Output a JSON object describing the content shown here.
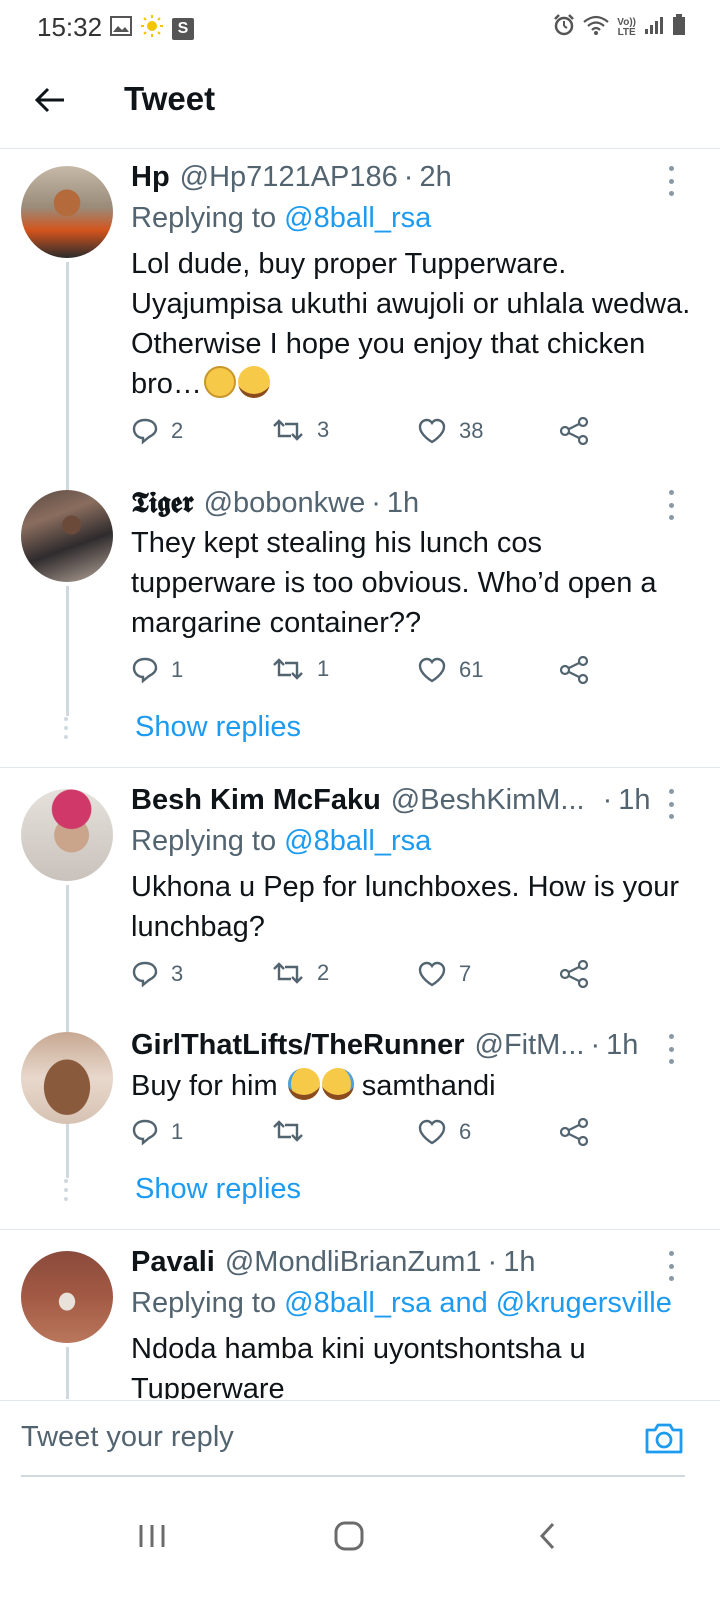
{
  "status_bar": {
    "time": "15:32",
    "volte_top": "Vo))",
    "volte_bottom": "LTE",
    "s_badge": "S"
  },
  "header": {
    "title": "Tweet",
    "back_icon": "arrow-left-icon"
  },
  "colors": {
    "accent": "#1d9bf0",
    "text": "#0f1419",
    "muted": "#536471",
    "divider": "#e1e6ea"
  },
  "tweets": [
    {
      "name": "Hp",
      "handle": "@Hp7121AP186",
      "dot": "·",
      "time": "2h",
      "replying_prefix": "Replying to",
      "replying_to": "@8ball_rsa",
      "text": "Lol dude, buy proper Tupperware. Uyajumpisa ukuthi awujoli or uhlala wedwa. Otherwise I hope you enjoy that chicken bro…",
      "replies": "2",
      "retweets": "3",
      "likes": "38"
    },
    {
      "name": "𝕿𝖎𝖌𝖊𝖗",
      "handle": "@bobonkwe",
      "dot": "·",
      "time": "1h",
      "text": "They kept stealing his lunch cos tupperware is too obvious. Who’d open a margarine container??",
      "replies": "1",
      "retweets": "1",
      "likes": "61",
      "show_replies": "Show replies"
    },
    {
      "name": "Besh Kim McFaku",
      "handle": "@BeshKimM...",
      "dot": "·",
      "time": "1h",
      "replying_prefix": "Replying to",
      "replying_to": "@8ball_rsa",
      "text": "Ukhona u Pep for lunchboxes. How is your lunchbag?",
      "replies": "3",
      "retweets": "2",
      "likes": "7"
    },
    {
      "name": "GirlThatLifts/TheRunner",
      "handle": "@FitM...",
      "dot": "·",
      "time": "1h",
      "text_before": "Buy for him",
      "text_after": "samthandi",
      "replies": "1",
      "retweets": "",
      "likes": "6",
      "show_replies": "Show replies"
    },
    {
      "name": "Pavali",
      "handle": "@MondliBrianZum1",
      "dot": "·",
      "time": "1h",
      "replying_prefix": "Replying to",
      "replying_to": "@8ball_rsa and @krugersville",
      "text": "Ndoda hamba kini uyontshontsha u Tupperware"
    }
  ],
  "reply_bar": {
    "placeholder": "Tweet your reply",
    "camera_icon": "camera-icon"
  },
  "nav_bar": {
    "recents_icon": "recents-icon",
    "home_icon": "home-icon",
    "back_icon": "back-chevron-icon"
  }
}
